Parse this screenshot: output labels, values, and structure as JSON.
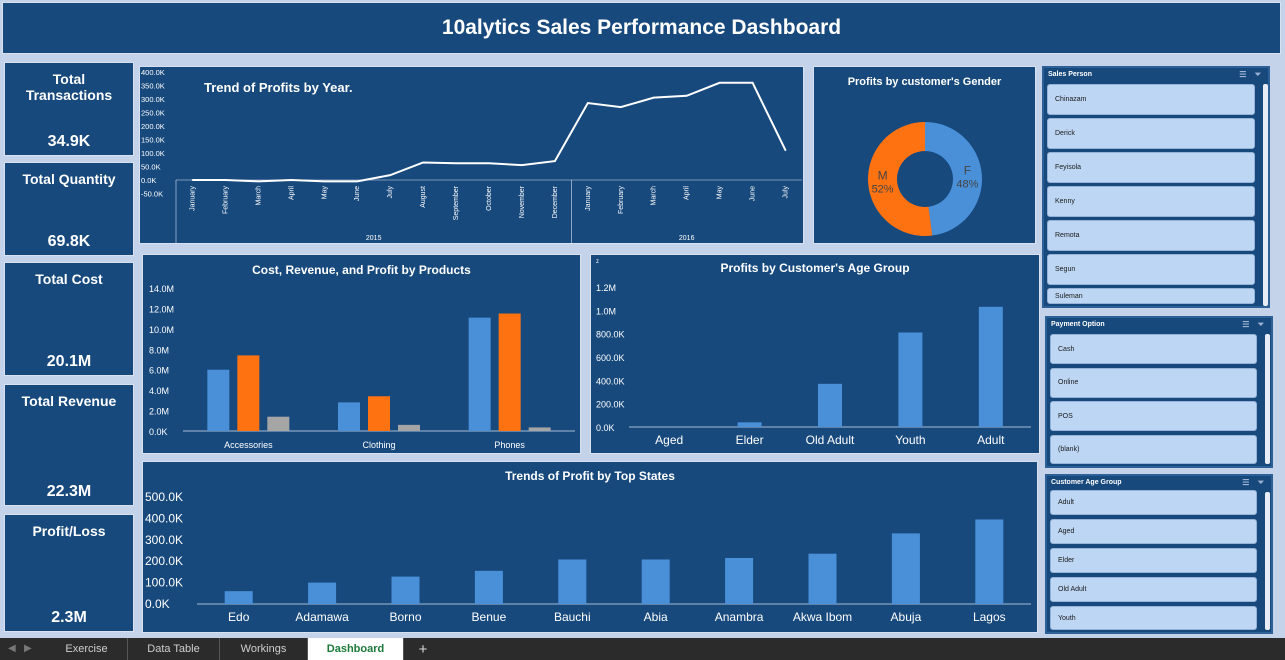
{
  "title": "10alytics Sales Performance Dashboard",
  "kpis": [
    {
      "label": "Total Transactions",
      "value": "34.9K"
    },
    {
      "label": "Total Quantity",
      "value": "69.8K"
    },
    {
      "label": "Total Cost",
      "value": "20.1M"
    },
    {
      "label": "Total Revenue",
      "value": "22.3M"
    },
    {
      "label": "Profit/Loss",
      "value": "2.3M"
    }
  ],
  "colors": {
    "blue": "#4a90d9",
    "orange": "#ff7212",
    "gray": "#a5a5a5",
    "panel": "#17497d",
    "line": "#ffffff"
  },
  "chart_data": [
    {
      "type": "line",
      "title": "Trend of Profits by Year.",
      "categories": [
        "January",
        "February",
        "March",
        "April",
        "May",
        "June",
        "July",
        "August",
        "September",
        "October",
        "November",
        "December",
        "January",
        "February",
        "March",
        "April",
        "May",
        "June",
        "July"
      ],
      "groups": [
        {
          "name": "2015",
          "count": 12
        },
        {
          "name": "2016",
          "count": 7
        }
      ],
      "values": [
        0,
        0,
        -5000,
        0,
        -5000,
        -5000,
        18000,
        65000,
        62000,
        62000,
        55000,
        70000,
        285000,
        270000,
        305000,
        312000,
        360000,
        360000,
        110000
      ],
      "yticks": [
        "400.0K",
        "350.0K",
        "300.0K",
        "250.0K",
        "200.0K",
        "150.0K",
        "100.0K",
        "50.0K",
        "0.0K",
        "-50.0K"
      ],
      "ylim": [
        -50000,
        400000
      ]
    },
    {
      "type": "pie",
      "title": "Profits by customer's Gender",
      "slices": [
        {
          "label": "F",
          "pct": "48%",
          "value": 48,
          "color": "#4a90d9"
        },
        {
          "label": "M",
          "pct": "52%",
          "value": 52,
          "color": "#ff7212"
        }
      ]
    },
    {
      "type": "bar",
      "title": "Cost, Revenue, and Profit by Products",
      "categories": [
        "Accessories",
        "Clothing",
        "Phones"
      ],
      "series": [
        {
          "values": [
            6.0,
            2.8,
            11.1
          ],
          "color": "#4a90d9"
        },
        {
          "values": [
            7.4,
            3.4,
            11.5
          ],
          "color": "#ff7212"
        },
        {
          "values": [
            1.4,
            0.6,
            0.35
          ],
          "color": "#a5a5a5"
        }
      ],
      "yticks": [
        "14.0M",
        "12.0M",
        "10.0M",
        "8.0M",
        "6.0M",
        "4.0M",
        "2.0M",
        "0.0K"
      ],
      "ylim": [
        0,
        14
      ]
    },
    {
      "type": "bar",
      "title": "Profits by Customer's Age Group",
      "categories": [
        "Aged",
        "Elder",
        "Old Adult",
        "Youth",
        "Adult"
      ],
      "values": [
        0,
        40000,
        370000,
        810000,
        1030000
      ],
      "yticks": [
        "1.2M",
        "1.0M",
        "800.0K",
        "600.0K",
        "400.0K",
        "200.0K",
        "0.0K"
      ],
      "ylim": [
        0,
        1200000
      ],
      "corner_label": "z"
    },
    {
      "type": "bar",
      "title": "Trends of Profit by Top States",
      "categories": [
        "Edo",
        "Adamawa",
        "Borno",
        "Benue",
        "Bauchi",
        "Abia",
        "Anambra",
        "Akwa Ibom",
        "Abuja",
        "Lagos"
      ],
      "values": [
        60000,
        100000,
        128000,
        155000,
        208000,
        208000,
        215000,
        235000,
        330000,
        395000
      ],
      "yticks": [
        "500.0K",
        "400.0K",
        "300.0K",
        "200.0K",
        "100.0K",
        "0.0K"
      ],
      "ylim": [
        0,
        500000
      ]
    }
  ],
  "slicers": [
    {
      "title": "Sales Person",
      "items": [
        "Chinazam",
        "Derick",
        "Feyisola",
        "Kenny",
        "Remota",
        "Segun",
        "Suleman"
      ]
    },
    {
      "title": "Payment Option",
      "items": [
        "Cash",
        "Online",
        "POS",
        "(blank)"
      ]
    },
    {
      "title": "Customer Age Group",
      "items": [
        "Adult",
        "Aged",
        "Elder",
        "Old Adult",
        "Youth"
      ]
    }
  ],
  "sheet_tabs": [
    {
      "label": "Exercise",
      "active": false
    },
    {
      "label": "Data Table",
      "active": false
    },
    {
      "label": "Workings",
      "active": false
    },
    {
      "label": "Dashboard",
      "active": true
    }
  ],
  "add_sheet": "+"
}
